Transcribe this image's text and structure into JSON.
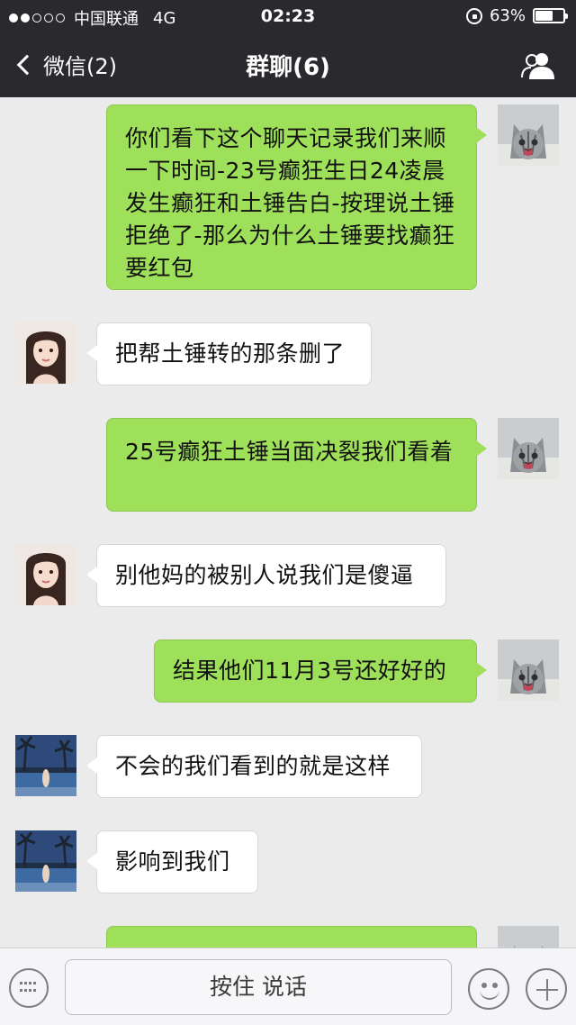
{
  "status": {
    "carrier": "中国联通",
    "network": "4G",
    "time": "02:23",
    "battery": "63%",
    "signal_bars": 2,
    "battery_level": 0.63
  },
  "nav": {
    "back_label": "微信(2)",
    "title": "群聊(6)"
  },
  "messages": [
    {
      "side": "right",
      "avatar": "kitten",
      "text": "你们看下这个聊天记录我们来顺一下时间-23号癫狂生日24凌晨发生癫狂和土锤告白-按理说土锤拒绝了-那么为什么土锤要找癫狂要红包"
    },
    {
      "side": "left",
      "avatar": "girl",
      "text": "把帮土锤转的那条删了"
    },
    {
      "side": "right",
      "avatar": "kitten",
      "text": "25号癫狂土锤当面决裂我们看着"
    },
    {
      "side": "left",
      "avatar": "girl",
      "text": "别他妈的被别人说我们是傻逼"
    },
    {
      "side": "right",
      "avatar": "kitten",
      "text": "结果他们11月3号还好好的"
    },
    {
      "side": "left",
      "avatar": "beach",
      "text": "不会的我们看到的就是这样"
    },
    {
      "side": "left",
      "avatar": "beach",
      "text": "影响到我们"
    },
    {
      "side": "right",
      "avatar": "kitten",
      "text": ""
    }
  ],
  "input": {
    "hold_to_talk": "按住 说话"
  },
  "colors": {
    "bar": "#2a2a2e",
    "sent_bubble": "#9fe05a",
    "received_bubble": "#ffffff",
    "chat_bg": "#ebebeb"
  }
}
